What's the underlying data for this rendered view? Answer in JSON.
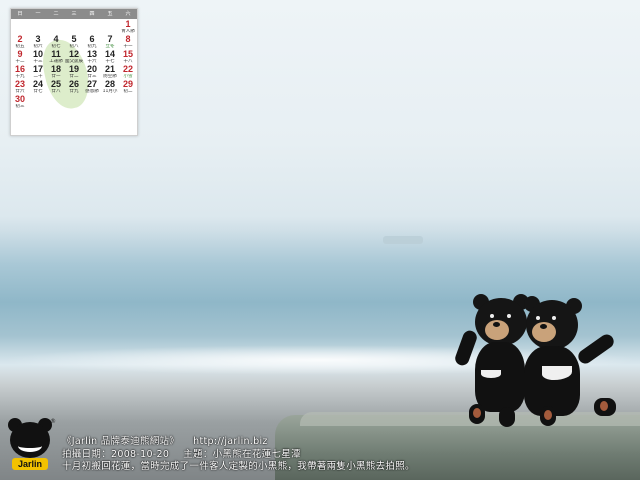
{
  "calendar": {
    "weekdays": [
      "日",
      "一",
      "二",
      "三",
      "四",
      "五",
      "六"
    ],
    "days": [
      {
        "n": "",
        "s": ""
      },
      {
        "n": "",
        "s": ""
      },
      {
        "n": "",
        "s": ""
      },
      {
        "n": "",
        "s": ""
      },
      {
        "n": "",
        "s": ""
      },
      {
        "n": "",
        "s": ""
      },
      {
        "n": "1",
        "s": "青人節",
        "red": true
      },
      {
        "n": "2",
        "s": "初五",
        "red": true
      },
      {
        "n": "3",
        "s": "初六"
      },
      {
        "n": "4",
        "s": "初七"
      },
      {
        "n": "5",
        "s": "初八"
      },
      {
        "n": "6",
        "s": "初九"
      },
      {
        "n": "7",
        "s": "立冬",
        "green": true
      },
      {
        "n": "8",
        "s": "十一",
        "red": true
      },
      {
        "n": "9",
        "s": "十二",
        "red": true
      },
      {
        "n": "10",
        "s": "十三"
      },
      {
        "n": "11",
        "s": "工運節"
      },
      {
        "n": "12",
        "s": "國父誕辰"
      },
      {
        "n": "13",
        "s": "十六"
      },
      {
        "n": "14",
        "s": "十七"
      },
      {
        "n": "15",
        "s": "十八",
        "red": true
      },
      {
        "n": "16",
        "s": "十九",
        "red": true
      },
      {
        "n": "17",
        "s": "二十"
      },
      {
        "n": "18",
        "s": "廿一"
      },
      {
        "n": "19",
        "s": "廿二"
      },
      {
        "n": "20",
        "s": "廿三"
      },
      {
        "n": "21",
        "s": "防空節"
      },
      {
        "n": "22",
        "s": "小雪",
        "red": true,
        "green": true
      },
      {
        "n": "23",
        "s": "廿六",
        "red": true
      },
      {
        "n": "24",
        "s": "廿七"
      },
      {
        "n": "25",
        "s": "廿八"
      },
      {
        "n": "26",
        "s": "廿九"
      },
      {
        "n": "27",
        "s": "感恩節"
      },
      {
        "n": "28",
        "s": "11月小"
      },
      {
        "n": "29",
        "s": "初二",
        "red": true
      },
      {
        "n": "30",
        "s": "初三",
        "red": true
      }
    ]
  },
  "logo": {
    "text": "Jarlin",
    "reg": "®"
  },
  "caption": {
    "line1_title": "《Jarlin 品牌泰迪熊網站》",
    "line1_url": "http://jarlin.biz",
    "line2_date": "拍攝日期：2008-10-20",
    "line2_theme": "主題：小黑熊在花蓮七星潭",
    "line3": "十月初搬回花蓮，當時完成了一件客人定製的小黑熊，我帶著兩隻小黑熊去拍照。"
  },
  "colors": {
    "sky": "#eef4f7",
    "sea": "#8fb7c8",
    "calendar_red": "#c0262d",
    "calendar_green": "#3c8b3a",
    "logo_yellow": "#f2c200"
  }
}
